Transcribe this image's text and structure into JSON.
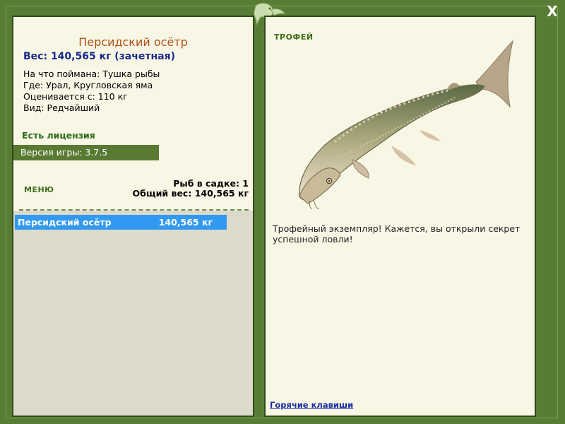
{
  "fish": {
    "title": "Персидский осётр",
    "weight_line": "Вес: 140,565 кг (зачетная)",
    "caught_on": "На что поймана: Тушка рыбы",
    "location": "Где: Урал, Кругловская яма",
    "rated_from": "Оценивается с: 110 кг",
    "rarity": "Вид: Редчайший"
  },
  "license_text": "Есть лицензия",
  "version_text": "Версия игры: 3.7.5",
  "menu_label": "МЕНЮ",
  "stats": {
    "fish_count": "Рыб в садке: 1",
    "total_weight": "Общий вес: 140,565 кг"
  },
  "catch_list": [
    {
      "name": "Персидский осётр",
      "weight": "140,565 кг"
    }
  ],
  "trophy_label": "ТРОФЕЙ",
  "description": "Трофейный экземпляр! Кажется, вы открыли секрет успешной ловли!",
  "hotkeys_link": "Горячие клавиши",
  "close_label": "X",
  "icons": {
    "close": "close-icon",
    "logo": "fish-logo-icon"
  },
  "colors": {
    "frame": "#587c35",
    "panel": "#f8f7e6",
    "highlight": "#3299f0"
  }
}
